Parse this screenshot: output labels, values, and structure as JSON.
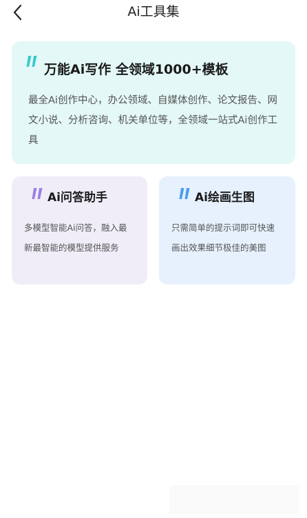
{
  "header": {
    "title": "Ai工具集",
    "back_icon": "chevron-left-icon"
  },
  "cards": {
    "writing": {
      "title": "万能Ai写作 全领域1000+模板",
      "description": "最全Ai创作中心，办公领域、自媒体创作、论文报告、网文小说、分析咨询、机关单位等，全领域一站式Ai创作工具",
      "accent_color": "#3cc8d0",
      "background": "#e3f8f7"
    },
    "chat": {
      "title": "Ai问答助手",
      "description": "多模型智能Ai问答，融入最新最智能的模型提供服务",
      "accent_color": "#9b7fe0",
      "background": "#f0edf9"
    },
    "draw": {
      "title": "Ai绘画生图",
      "description": "只需简单的提示词即可快速画出效果细节极佳的美图",
      "accent_color": "#4a9cf0",
      "background": "#e6f1fd"
    }
  }
}
